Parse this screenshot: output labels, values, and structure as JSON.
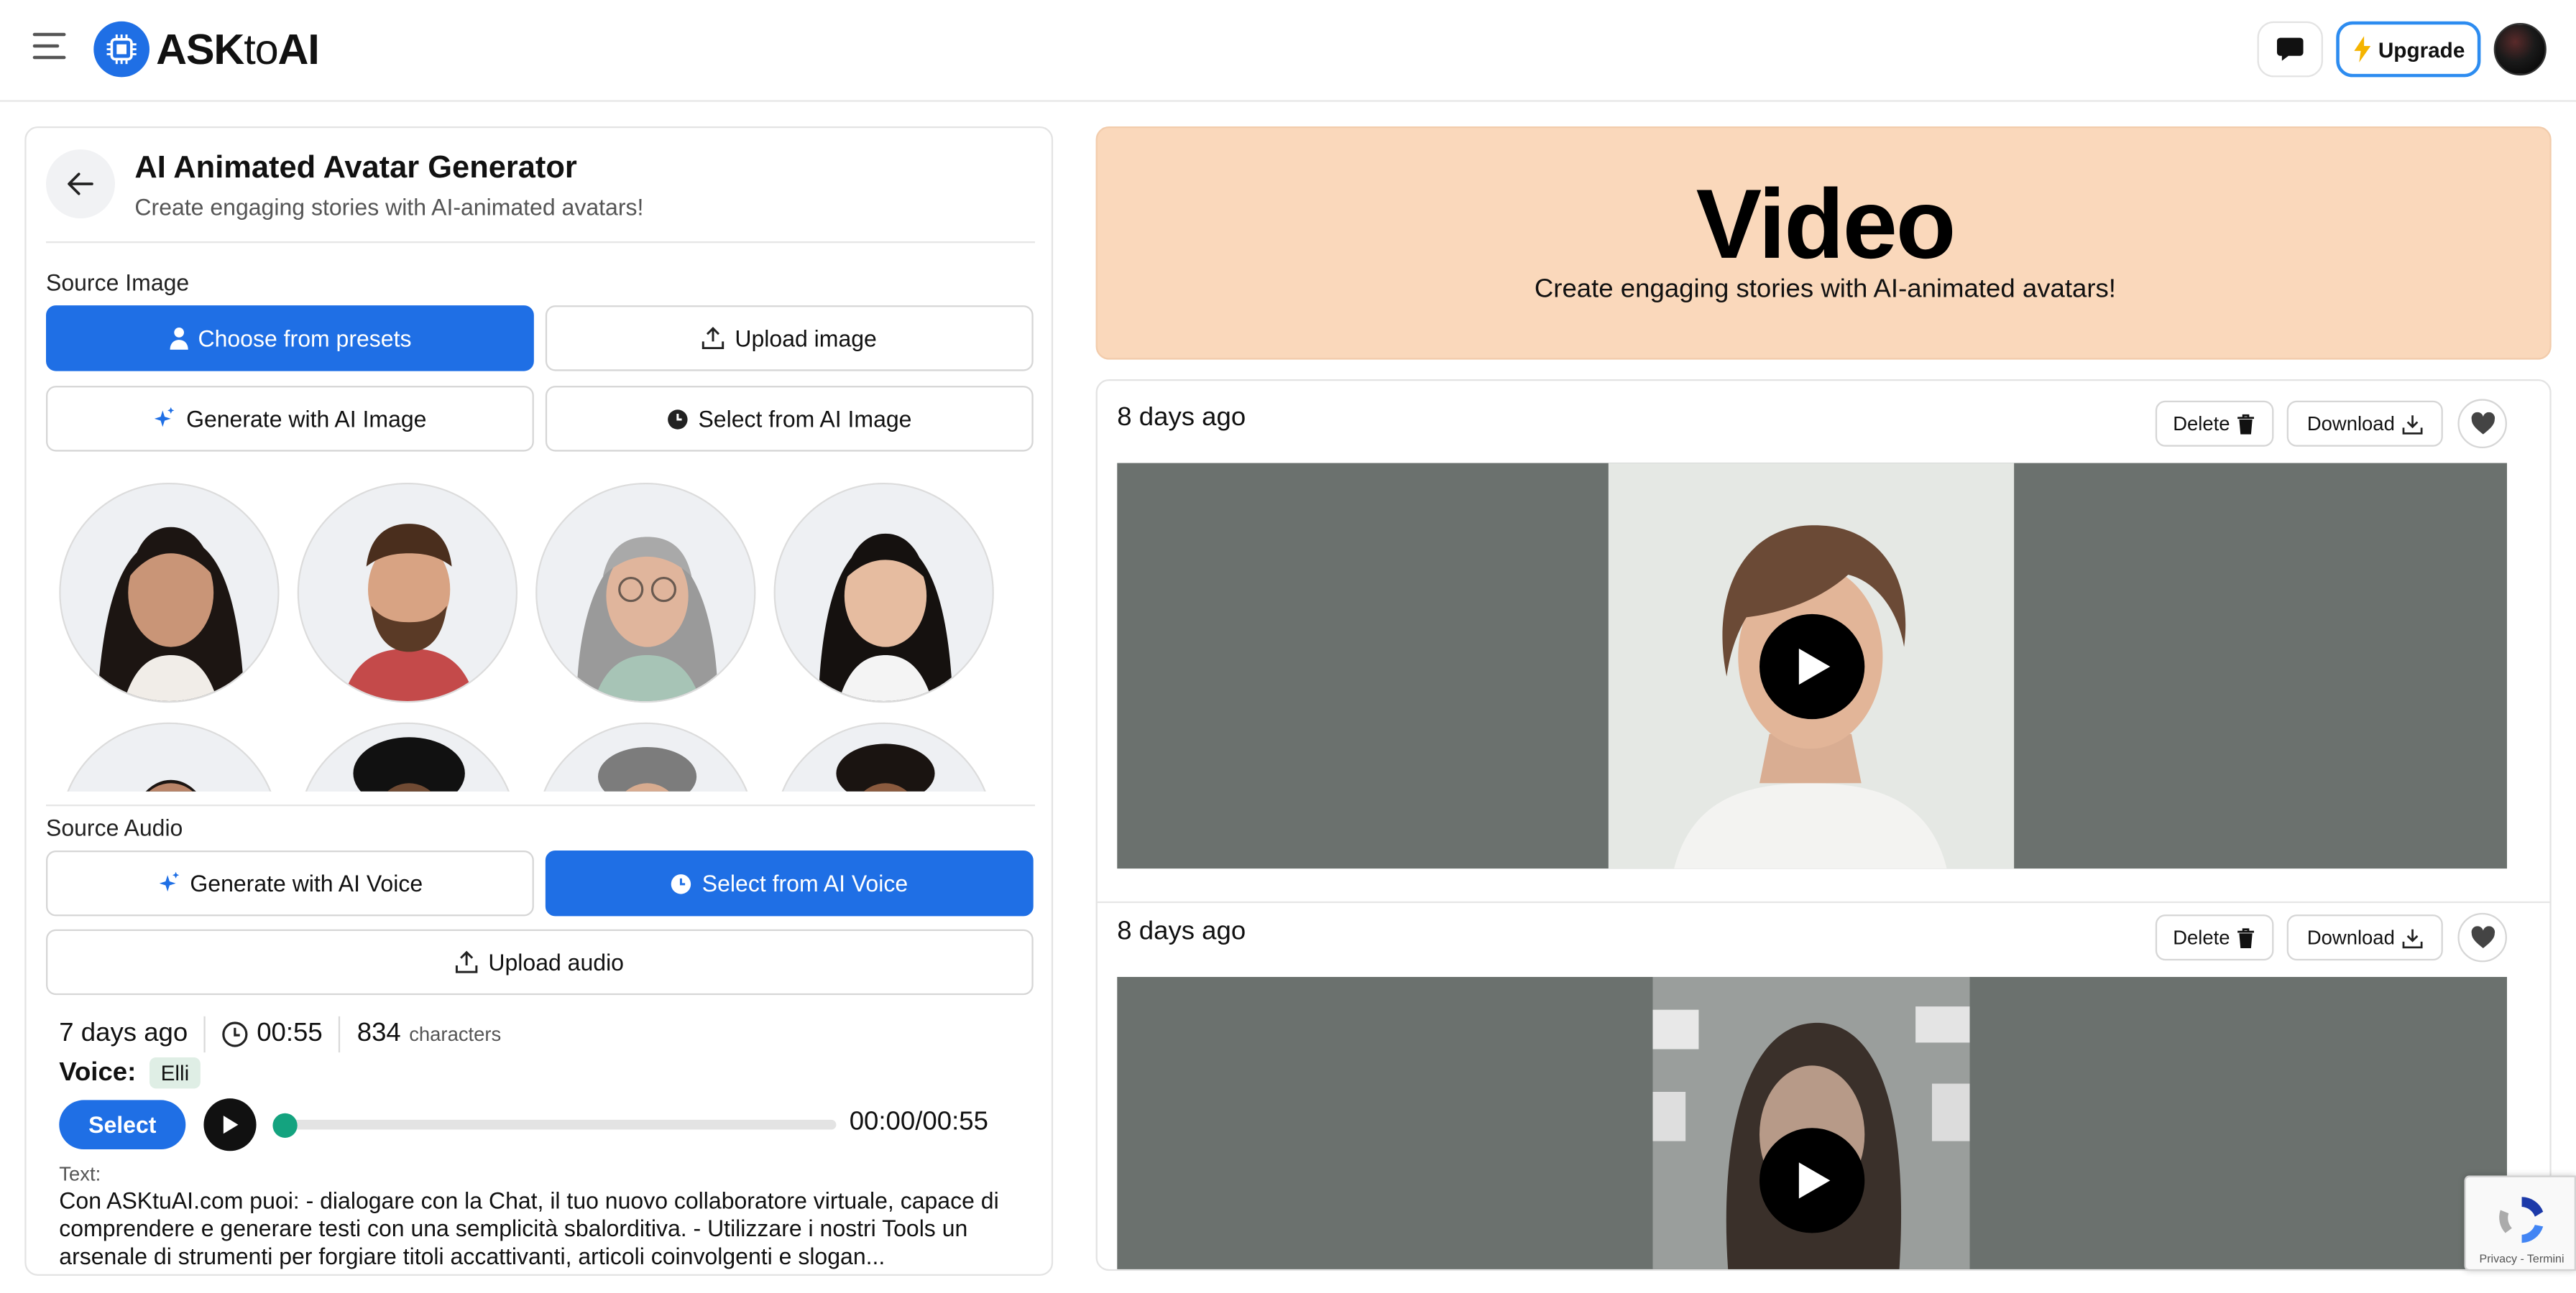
{
  "header": {
    "logo_prefix": "ASK",
    "logo_mid": "to",
    "logo_suffix": "AI",
    "upgrade_label": "Upgrade"
  },
  "generator": {
    "title": "AI Animated Avatar Generator",
    "subtitle": "Create engaging stories with AI-animated avatars!",
    "source_image_label": "Source Image",
    "image_buttons": {
      "presets": "Choose from presets",
      "upload": "Upload image",
      "generate": "Generate with AI Image",
      "select": "Select from AI Image"
    },
    "source_audio_label": "Source Audio",
    "audio_buttons": {
      "generate": "Generate with AI Voice",
      "select": "Select from AI Voice",
      "upload": "Upload audio"
    }
  },
  "audio_item": {
    "age": "7 days ago",
    "duration": "00:55",
    "char_count": "834",
    "char_unit": "characters",
    "voice_label": "Voice:",
    "voice_name": "Elli",
    "select_label": "Select",
    "playback_time": "00:00/00:55",
    "playback_progress": 0,
    "text_label": "Text:",
    "text": "Con ASKtuAI.com puoi: - dialogare con la Chat, il tuo nuovo collaboratore virtuale, capace di comprendere e generare testi con una semplicità sbalorditiva. - Utilizzare i nostri Tools un arsenale di strumenti per forgiare titoli accattivanti, articoli coinvolgenti e slogan..."
  },
  "hero": {
    "title": "Video",
    "subtitle": "Create engaging stories with AI-animated avatars!"
  },
  "videos": [
    {
      "age": "8 days ago",
      "delete_label": "Delete",
      "download_label": "Download"
    },
    {
      "age": "8 days ago",
      "delete_label": "Delete",
      "download_label": "Download"
    }
  ],
  "recaptcha": {
    "footer": "Privacy - Termini"
  },
  "colors": {
    "accent": "#1f6fe5",
    "hero_bg": "#fad8bb",
    "progress_knob": "#14a37f",
    "voice_chip": "#dfeee5",
    "video_letterbox": "#6b716e"
  }
}
